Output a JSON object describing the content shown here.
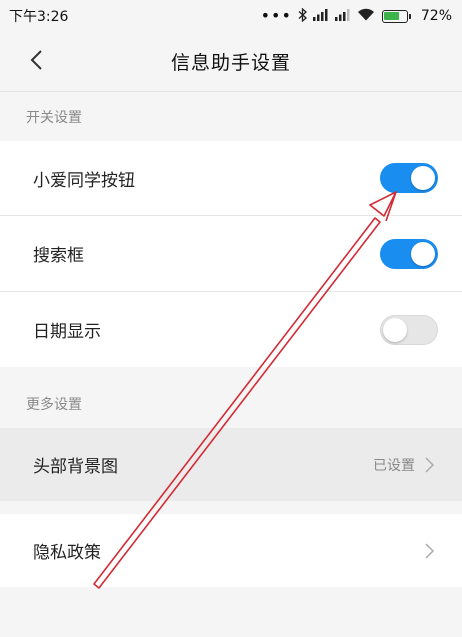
{
  "status_bar": {
    "time": "下午3:26",
    "dots": "•••",
    "bluetooth_icon": "bluetooth-icon",
    "signal_icon": "signal-icon",
    "wifi_icon": "wifi-icon",
    "battery_percent": "72%",
    "battery_level": 0.72,
    "battery_color": "#3bb54a"
  },
  "header": {
    "title": "信息助手设置",
    "back_icon": "chevron-left-icon"
  },
  "sections": [
    {
      "title": "开关设置",
      "items": [
        {
          "label": "小爱同学按钮",
          "toggle": "on"
        },
        {
          "label": "搜索框",
          "toggle": "on"
        },
        {
          "label": "日期显示",
          "toggle": "off"
        }
      ]
    },
    {
      "title": "更多设置",
      "items": [
        {
          "label": "头部背景图",
          "value": "已设置",
          "icon": "chevron-right-icon"
        },
        {
          "label": "隐私政策",
          "icon": "chevron-right-icon"
        }
      ]
    }
  ],
  "colors": {
    "accent": "#1a8df0",
    "annotation_arrow": "#d42a35"
  }
}
